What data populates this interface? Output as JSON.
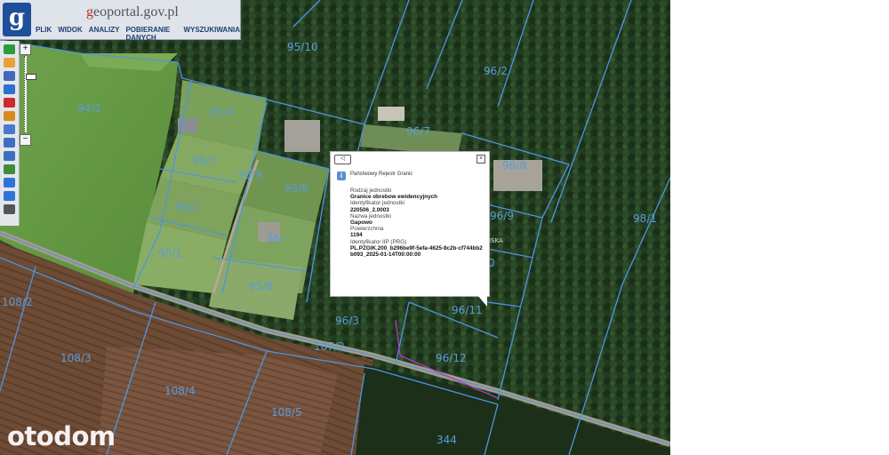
{
  "header": {
    "logo_letter": "g",
    "site_prefix": "g",
    "site_rest": "eoportal.gov.pl",
    "menu": [
      "PLIK",
      "WIDOK",
      "ANALIZY",
      "POBIERANIE DANYCH",
      "WYSZUKIWANIA"
    ]
  },
  "toolbar": {
    "tools": [
      "info-icon",
      "hand-pan-icon",
      "legend-icon",
      "select-area-icon",
      "measure-icon",
      "edit-pencil-icon",
      "ruler-icon",
      "zoom-in-icon",
      "zoom-out-icon",
      "globe-icon",
      "arrow-back-icon",
      "arrow-forward-icon",
      "settings-gear-icon"
    ],
    "colors": [
      "#2e9a3a",
      "#e8a13a",
      "#4466bb",
      "#2f6fd0",
      "#cc2b2b",
      "#d98a1f",
      "#4a7ac9",
      "#3c6fc0",
      "#3c6fc0",
      "#3f8c3f",
      "#2f73d8",
      "#2f73d8",
      "#555555"
    ]
  },
  "zoom": {
    "plus": "+",
    "minus": "−",
    "level_fraction": 0.25
  },
  "map": {
    "parcels": [
      "95/10",
      "96/2",
      "94/2",
      "95/4",
      "96/7",
      "96/8",
      "95/3",
      "95/9",
      "95/6",
      "96/9",
      "95/2",
      "98/1",
      "95/1",
      "95/8",
      "108/2",
      "96/3",
      "96/11",
      "107/2",
      "108/3",
      "96/12",
      "108/4",
      "108/5",
      "344",
      "0"
    ],
    "fragments": [
      "ISKA",
      "96/"
    ]
  },
  "popup": {
    "back_glyph": "◁",
    "close_glyph": "×",
    "info_glyph": "i",
    "header": "Państwowy Rejestr Granic",
    "fields": [
      {
        "label": "Rodzaj jednostki",
        "value": "Granice obrebow ewidencyjnych"
      },
      {
        "label": "Identyfikator jednostki",
        "value": "220506_2.0003"
      },
      {
        "label": "Nazwa jednostki",
        "value": "Gapowo"
      },
      {
        "label": "Powierzchnia",
        "value": "1194"
      },
      {
        "label": "Identyfikator IIP (PRG)",
        "value": "PL.PZGIK.200_b296be9f-5efa-4625-8c2b-cf744bb2b093_2025-01-14T00:00:00"
      }
    ]
  },
  "watermark": "otodom"
}
